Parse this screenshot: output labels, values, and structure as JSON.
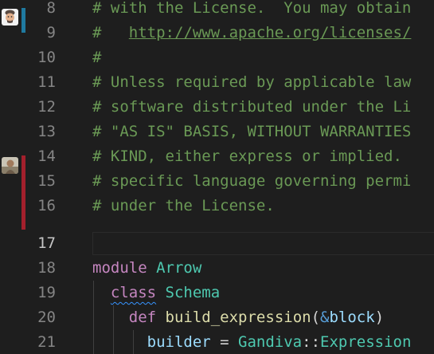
{
  "colors": {
    "background": "#1e1e1e",
    "comment": "#6a9955",
    "keyword": "#c586c0",
    "class_name": "#4ec9b0",
    "function": "#dcdcaa",
    "variable": "#9cdcfe",
    "blame_teal": "#1f7aa0",
    "blame_red": "#a3202c"
  },
  "editor": {
    "current_line_number": "17",
    "lines": [
      {
        "number": "8",
        "text": "# with the License.  You may obtain"
      },
      {
        "number": "9",
        "prefix": "#   ",
        "link": "http://www.apache.org/licenses/"
      },
      {
        "number": "10",
        "text": "#"
      },
      {
        "number": "11",
        "text": "# Unless required by applicable law"
      },
      {
        "number": "12",
        "text": "# software distributed under the Li"
      },
      {
        "number": "13",
        "text": "# \"AS IS\" BASIS, WITHOUT WARRANTIES"
      },
      {
        "number": "14",
        "text": "# KIND, either express or implied."
      },
      {
        "number": "15",
        "text": "# specific language governing permi"
      },
      {
        "number": "16",
        "text": "# under the License."
      },
      {
        "number": "17",
        "text": ""
      },
      {
        "number": "18",
        "kw": "module",
        "name": "Arrow"
      },
      {
        "number": "19",
        "kw": "class",
        "name": "Schema"
      },
      {
        "number": "20",
        "kw": "def",
        "fn": "build_expression",
        "open": "(",
        "amp": "&",
        "arg": "block",
        "close": ")"
      },
      {
        "number": "21",
        "var": "builder",
        "op": " = ",
        "cls": "Gandiva",
        "sep": "::",
        "name": "Expression"
      }
    ]
  },
  "gutter": {
    "avatar_top": "memoji-avatar",
    "avatar_mid": "author-photo-avatar"
  }
}
